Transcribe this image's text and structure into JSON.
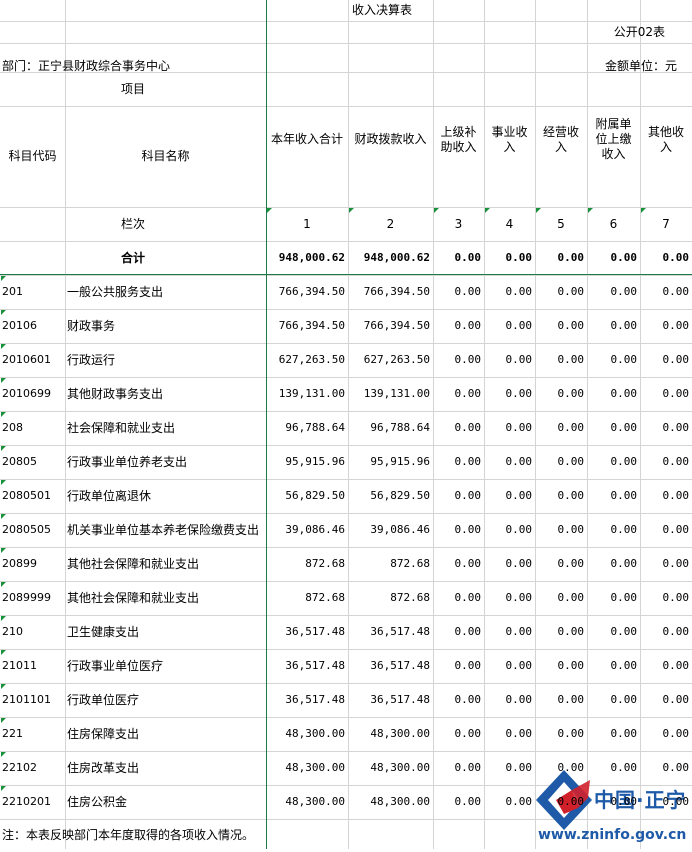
{
  "title": "收入决算表",
  "form_code": "公开02表",
  "department": "部门：正宁县财政综合事务中心",
  "unit": "金额单位：元",
  "header": {
    "xiangmu": "项目",
    "code_col": "科目代码",
    "name_col": "科目名称",
    "cols": [
      "本年收入合计",
      "财政拨款收入",
      "上级补助收入",
      "事业收入",
      "经营收入",
      "附属单位上缴收入",
      "其他收入"
    ],
    "lanci": "栏次",
    "col_nums": [
      "1",
      "2",
      "3",
      "4",
      "5",
      "6",
      "7"
    ]
  },
  "total": {
    "label": "合计",
    "values": [
      "948,000.62",
      "948,000.62",
      "0.00",
      "0.00",
      "0.00",
      "0.00",
      "0.00"
    ]
  },
  "rows": [
    {
      "code": "201",
      "name": "一般公共服务支出",
      "values": [
        "766,394.50",
        "766,394.50",
        "0.00",
        "0.00",
        "0.00",
        "0.00",
        "0.00"
      ]
    },
    {
      "code": "20106",
      "name": "财政事务",
      "values": [
        "766,394.50",
        "766,394.50",
        "0.00",
        "0.00",
        "0.00",
        "0.00",
        "0.00"
      ]
    },
    {
      "code": "2010601",
      "name": "行政运行",
      "values": [
        "627,263.50",
        "627,263.50",
        "0.00",
        "0.00",
        "0.00",
        "0.00",
        "0.00"
      ]
    },
    {
      "code": "2010699",
      "name": "其他财政事务支出",
      "values": [
        "139,131.00",
        "139,131.00",
        "0.00",
        "0.00",
        "0.00",
        "0.00",
        "0.00"
      ]
    },
    {
      "code": "208",
      "name": "社会保障和就业支出",
      "values": [
        "96,788.64",
        "96,788.64",
        "0.00",
        "0.00",
        "0.00",
        "0.00",
        "0.00"
      ]
    },
    {
      "code": "20805",
      "name": "行政事业单位养老支出",
      "values": [
        "95,915.96",
        "95,915.96",
        "0.00",
        "0.00",
        "0.00",
        "0.00",
        "0.00"
      ]
    },
    {
      "code": "2080501",
      "name": "行政单位离退休",
      "values": [
        "56,829.50",
        "56,829.50",
        "0.00",
        "0.00",
        "0.00",
        "0.00",
        "0.00"
      ]
    },
    {
      "code": "2080505",
      "name": "机关事业单位基本养老保险缴费支出",
      "values": [
        "39,086.46",
        "39,086.46",
        "0.00",
        "0.00",
        "0.00",
        "0.00",
        "0.00"
      ]
    },
    {
      "code": "20899",
      "name": "其他社会保障和就业支出",
      "values": [
        "872.68",
        "872.68",
        "0.00",
        "0.00",
        "0.00",
        "0.00",
        "0.00"
      ]
    },
    {
      "code": "2089999",
      "name": "其他社会保障和就业支出",
      "values": [
        "872.68",
        "872.68",
        "0.00",
        "0.00",
        "0.00",
        "0.00",
        "0.00"
      ]
    },
    {
      "code": "210",
      "name": "卫生健康支出",
      "values": [
        "36,517.48",
        "36,517.48",
        "0.00",
        "0.00",
        "0.00",
        "0.00",
        "0.00"
      ]
    },
    {
      "code": "21011",
      "name": "行政事业单位医疗",
      "values": [
        "36,517.48",
        "36,517.48",
        "0.00",
        "0.00",
        "0.00",
        "0.00",
        "0.00"
      ]
    },
    {
      "code": "2101101",
      "name": "行政单位医疗",
      "values": [
        "36,517.48",
        "36,517.48",
        "0.00",
        "0.00",
        "0.00",
        "0.00",
        "0.00"
      ]
    },
    {
      "code": "221",
      "name": "住房保障支出",
      "values": [
        "48,300.00",
        "48,300.00",
        "0.00",
        "0.00",
        "0.00",
        "0.00",
        "0.00"
      ]
    },
    {
      "code": "22102",
      "name": "住房改革支出",
      "values": [
        "48,300.00",
        "48,300.00",
        "0.00",
        "0.00",
        "0.00",
        "0.00",
        "0.00"
      ]
    },
    {
      "code": "2210201",
      "name": "住房公积金",
      "values": [
        "48,300.00",
        "48,300.00",
        "0.00",
        "0.00",
        "0.00",
        "0.00",
        "0.00"
      ]
    }
  ],
  "note": "注：本表反映部门本年度取得的各项收入情况。",
  "watermark": {
    "brand": "中国·正宁",
    "url": "www.zninfo.gov.cn",
    "colors": {
      "blue": "#1e5aa8",
      "red": "#d0202a"
    }
  }
}
